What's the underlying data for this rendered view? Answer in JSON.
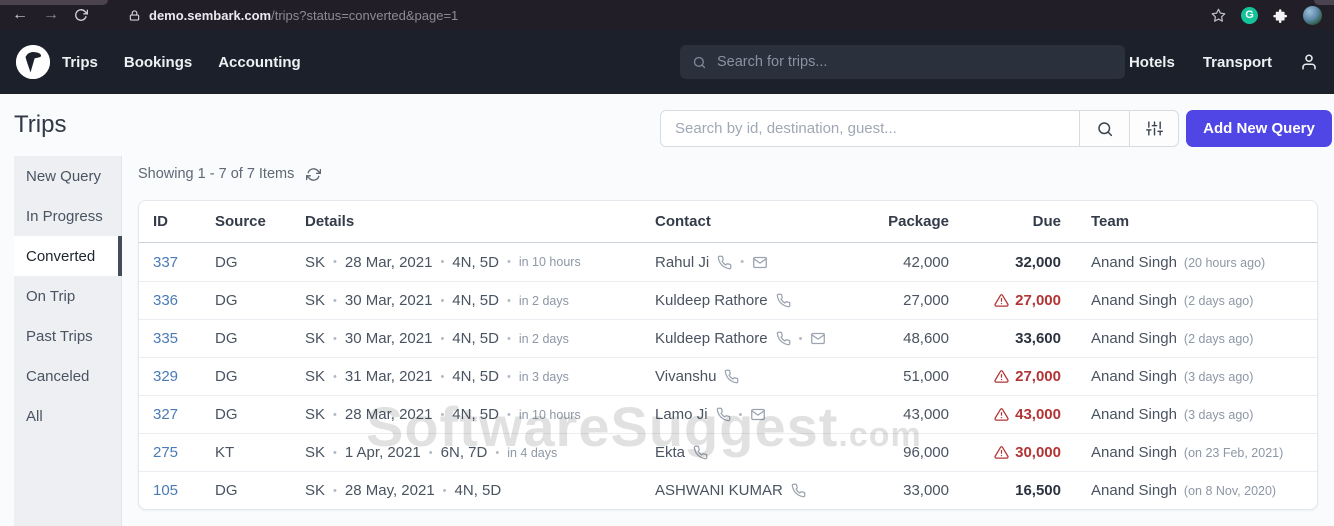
{
  "browser": {
    "url_host": "demo.sembark.com",
    "url_path": "/trips?status=converted&page=1",
    "grammarly_letter": "G"
  },
  "icons": {
    "back": "←",
    "forward": "→",
    "bullet": "•"
  },
  "navbar": {
    "links": [
      {
        "label": "Trips"
      },
      {
        "label": "Bookings"
      },
      {
        "label": "Accounting"
      }
    ],
    "search_placeholder": "Search for trips...",
    "right_links": [
      {
        "label": "Hotels"
      },
      {
        "label": "Transport"
      }
    ]
  },
  "page": {
    "title": "Trips",
    "search_placeholder": "Search by id, destination, guest...",
    "add_button": "Add New Query"
  },
  "sidebar": {
    "items": [
      {
        "label": "New Query",
        "active": false
      },
      {
        "label": "In Progress",
        "active": false
      },
      {
        "label": "Converted",
        "active": true
      },
      {
        "label": "On Trip",
        "active": false
      },
      {
        "label": "Past Trips",
        "active": false
      },
      {
        "label": "Canceled",
        "active": false
      },
      {
        "label": "All",
        "active": false
      }
    ]
  },
  "list": {
    "summary": "Showing 1 - 7 of 7 Items",
    "columns": [
      "ID",
      "Source",
      "Details",
      "Contact",
      "Package",
      "Due",
      "Team"
    ],
    "rows": [
      {
        "id": "337",
        "source": "DG",
        "code": "SK",
        "date": "28 Mar, 2021",
        "duration": "4N, 5D",
        "relative": "in 10 hours",
        "contact": "Rahul Ji",
        "has_email": true,
        "package": "42,000",
        "due": "32,000",
        "overdue": false,
        "team": "Anand Singh",
        "team_time": "(20 hours ago)"
      },
      {
        "id": "336",
        "source": "DG",
        "code": "SK",
        "date": "30 Mar, 2021",
        "duration": "4N, 5D",
        "relative": "in 2 days",
        "contact": "Kuldeep Rathore",
        "has_email": false,
        "package": "27,000",
        "due": "27,000",
        "overdue": true,
        "team": "Anand Singh",
        "team_time": "(2 days ago)"
      },
      {
        "id": "335",
        "source": "DG",
        "code": "SK",
        "date": "30 Mar, 2021",
        "duration": "4N, 5D",
        "relative": "in 2 days",
        "contact": "Kuldeep Rathore",
        "has_email": true,
        "package": "48,600",
        "due": "33,600",
        "overdue": false,
        "team": "Anand Singh",
        "team_time": "(2 days ago)"
      },
      {
        "id": "329",
        "source": "DG",
        "code": "SK",
        "date": "31 Mar, 2021",
        "duration": "4N, 5D",
        "relative": "in 3 days",
        "contact": "Vivanshu",
        "has_email": false,
        "package": "51,000",
        "due": "27,000",
        "overdue": true,
        "team": "Anand Singh",
        "team_time": "(3 days ago)"
      },
      {
        "id": "327",
        "source": "DG",
        "code": "SK",
        "date": "28 Mar, 2021",
        "duration": "4N, 5D",
        "relative": "in 10 hours",
        "contact": "Lamo Ji",
        "has_email": true,
        "package": "43,000",
        "due": "43,000",
        "overdue": true,
        "team": "Anand Singh",
        "team_time": "(3 days ago)"
      },
      {
        "id": "275",
        "source": "KT",
        "code": "SK",
        "date": "1 Apr, 2021",
        "duration": "6N, 7D",
        "relative": "in 4 days",
        "contact": "Ekta",
        "has_email": false,
        "package": "96,000",
        "due": "30,000",
        "overdue": true,
        "team": "Anand Singh",
        "team_time": "(on 23 Feb, 2021)"
      },
      {
        "id": "105",
        "source": "DG",
        "code": "SK",
        "date": "28 May, 2021",
        "duration": "4N, 5D",
        "relative": "",
        "contact": "ASHWANI KUMAR",
        "has_email": false,
        "package": "33,000",
        "due": "16,500",
        "overdue": false,
        "team": "Anand Singh",
        "team_time": "(on 8 Nov, 2020)"
      }
    ]
  },
  "watermark": {
    "text": "SoftwareSuggest",
    "tld": ".com"
  },
  "colors": {
    "accent": "#4f46e5",
    "overdue": "#b23434",
    "id_link": "#4a7bb7",
    "navbar_bg": "#1b202b",
    "grammarly": "#15c39a"
  }
}
